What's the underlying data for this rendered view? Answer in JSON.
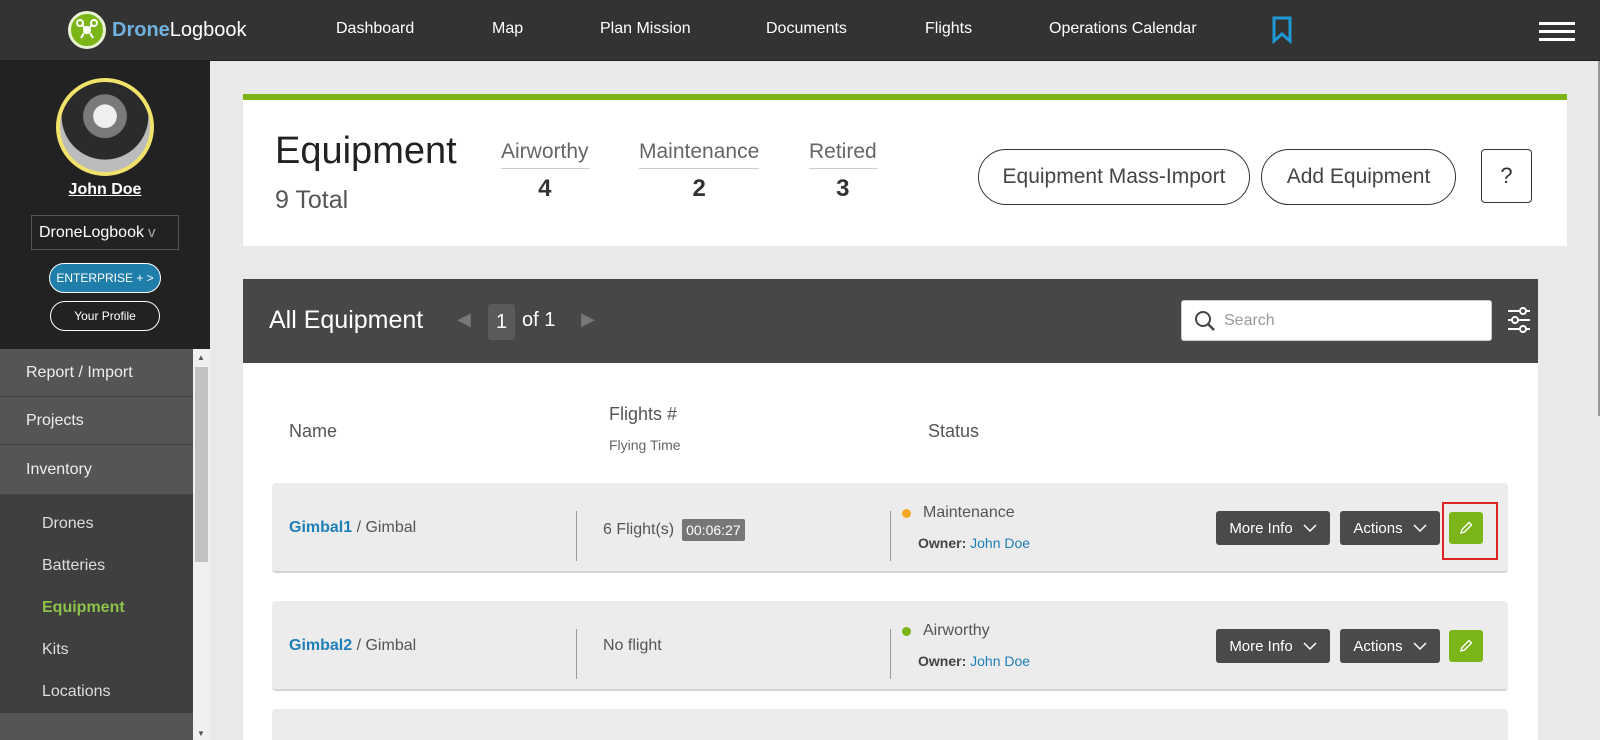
{
  "brand": {
    "name_a": "Drone",
    "name_b": "Logbook"
  },
  "nav": {
    "items": [
      "Dashboard",
      "Map",
      "Plan Mission",
      "Documents",
      "Flights",
      "Operations Calendar"
    ]
  },
  "user": {
    "name": "John Doe",
    "org": "DroneLogbook",
    "org_chevron": "v",
    "enterprise_label": "ENTERPRISE + >",
    "profile_label": "Your Profile"
  },
  "menu": {
    "items": [
      "Report / Import",
      "Projects",
      "Inventory"
    ],
    "subitems": [
      "Drones",
      "Batteries",
      "Equipment",
      "Kits",
      "Locations"
    ],
    "active": "Equipment"
  },
  "summary": {
    "title": "Equipment",
    "total": "9 Total",
    "stats": [
      {
        "label": "Airworthy",
        "value": "4"
      },
      {
        "label": "Maintenance",
        "value": "2"
      },
      {
        "label": "Retired",
        "value": "3"
      }
    ],
    "mass_import_label": "Equipment Mass-Import",
    "add_label": "Add Equipment",
    "help_label": "?"
  },
  "list": {
    "title": "All Equipment",
    "page": "1",
    "of_pages": "of 1",
    "search_placeholder": "Search",
    "columns": {
      "name": "Name",
      "flights": "Flights #",
      "flying_time": "Flying Time",
      "status": "Status"
    },
    "more_info_label": "More Info",
    "actions_label": "Actions",
    "owner_label": "Owner:",
    "rows": [
      {
        "name": "Gimbal1",
        "type": "/ Gimbal",
        "flights": "6 Flight(s)",
        "time": "00:06:27",
        "status": "Maintenance",
        "status_color": "#f5a623",
        "owner": "John Doe"
      },
      {
        "name": "Gimbal2",
        "type": "/ Gimbal",
        "flights": "No flight",
        "time": "",
        "status": "Airworthy",
        "status_color": "#7cb518",
        "owner": "John Doe"
      }
    ]
  },
  "colors": {
    "accent": "#7cb518",
    "link": "#1f7fb7",
    "enterprise": "#1f7faa",
    "highlight": "#e02424"
  }
}
